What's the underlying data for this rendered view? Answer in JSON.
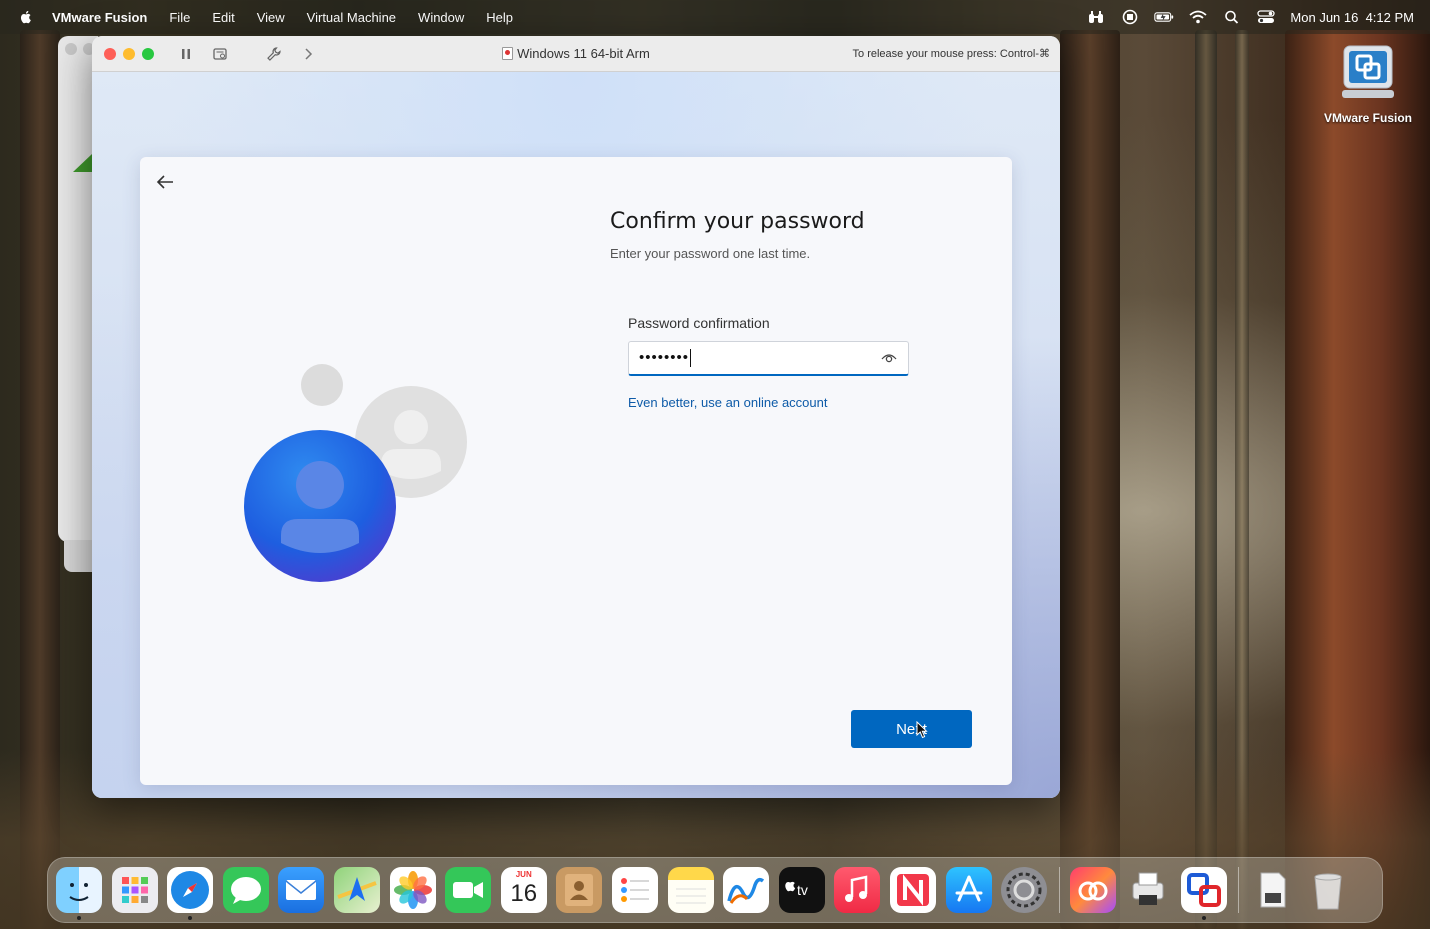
{
  "menubar": {
    "app_name": "VMware Fusion",
    "menus": [
      "File",
      "Edit",
      "View",
      "Virtual Machine",
      "Window",
      "Help"
    ],
    "status_icons": [
      "binoculars-icon",
      "vmware-status-icon",
      "battery-icon",
      "wifi-icon",
      "search-icon",
      "control-center-icon"
    ],
    "clock": "Mon Jun 16  4:12 PM"
  },
  "desktop": {
    "icon_label": "VMware Fusion"
  },
  "vm_window": {
    "title": "Windows 11 64-bit Arm",
    "release_hint": "To release your mouse press: Control-⌘"
  },
  "oobe": {
    "title": "Confirm your password",
    "subtitle": "Enter your password one last time.",
    "field_label": "Password confirmation",
    "password_value": "••••••••",
    "online_link": "Even better, use an online account",
    "next_label": "Next"
  },
  "dock": {
    "calendar_month": "JUN",
    "calendar_day": "16",
    "apps": [
      "Finder",
      "Launchpad",
      "Safari",
      "Messages",
      "Mail",
      "Maps",
      "Photos",
      "FaceTime",
      "Calendar",
      "Contacts",
      "Reminders",
      "Notes",
      "Freeform",
      "TV",
      "Music",
      "News",
      "App Store",
      "System Settings",
      "Creative Cloud",
      "Printer",
      "VMware Fusion",
      "Downloads",
      "Trash"
    ]
  },
  "colors": {
    "accent": "#0067c0",
    "link": "#0e5ba8"
  }
}
